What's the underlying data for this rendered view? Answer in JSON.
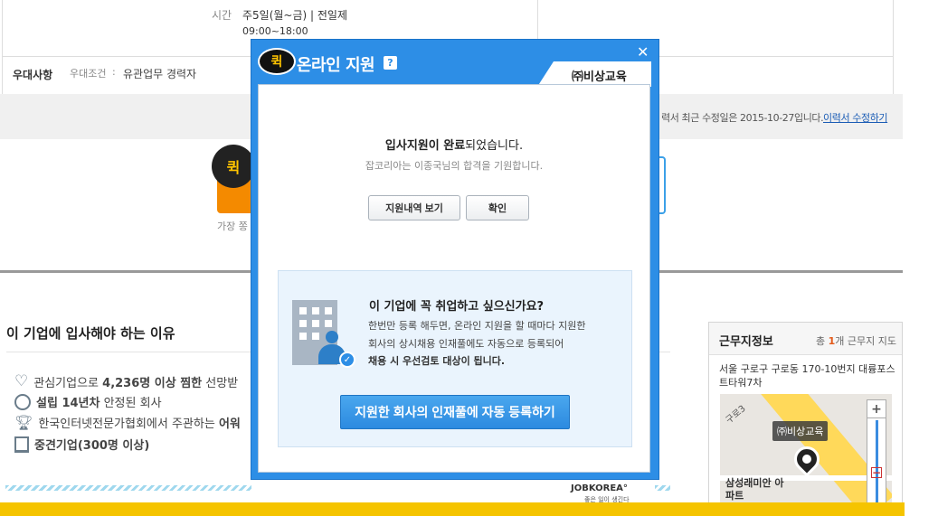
{
  "page": {
    "hours_label": "시간",
    "hours_value": "주5일(월~금) | 전일제",
    "hours_time": "09:00~18:00",
    "benefit_label": "우대사항",
    "benefit_sub_label": "우대조건",
    "benefit_value": "유관업무 경력자",
    "edit_notice": "력서 최근 수정일은 2015-10-27입니다.",
    "edit_link": "이력서 수정하기",
    "quick_badge": "퀵",
    "quick_sub": "가장 쫑",
    "reasons_title": "이 기업에 입사해야 하는 이유",
    "reasons": [
      {
        "pre": "관심기업으로 ",
        "bold": "4,236명 이상 찜한",
        "post": " 선망받"
      },
      {
        "pre": "",
        "bold": "설립 14년차",
        "post": " 안정된 회사"
      },
      {
        "pre": "한국인터넷전문가협회에서 주관하는 ",
        "bold": "어워",
        "post": ""
      },
      {
        "pre": "",
        "bold": "중견기업(300명 이상)",
        "post": ""
      }
    ],
    "footer_logo": "JOBKOREA°",
    "footer_logo_sub": "좋은 일이 생긴다",
    "location": {
      "title": "근무지정보",
      "count_prefix": "총 ",
      "count_num": "1",
      "count_suffix": "개 근무지 지도",
      "address": "서울 구로구 구로동 170-10번지 대륭포스트타워7차",
      "map_company": "㈜비상교육",
      "map_place": "삼성래미안 아파트",
      "map_road": "구로3"
    }
  },
  "modal": {
    "title": "온라인 지원",
    "help": "?",
    "close": "✕",
    "company_tab": "㈜비상교육",
    "complete_bold": "입사지원이 완료",
    "complete_rest": "되었습니다.",
    "complete_sub": "잡코리아는 이종국님의 합격을 기원합니다.",
    "btn_history": "지원내역 보기",
    "btn_ok": "확인",
    "promo_title": "이 기업에 꼭 취업하고 싶으신가요?",
    "promo_line1": "한번만 등록 해두면, 온라인 지원을 할 때마다 지원한",
    "promo_line2": "회사의 상시채용 인재풀에도 자동으로 등록되어",
    "promo_line3": "채용 시 우선검토 대상이 됩니다.",
    "promo_button": "지원한 회사의 인재풀에 자동 등록하기"
  }
}
